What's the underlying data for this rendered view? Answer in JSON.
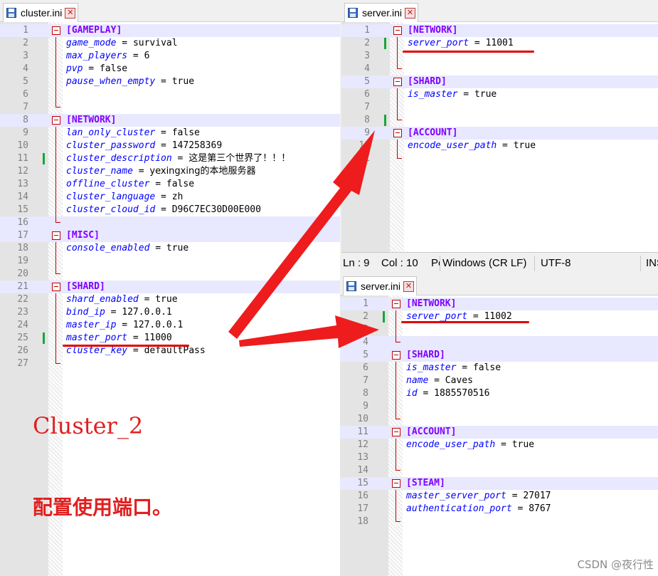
{
  "colors": {
    "section": "#8000ff",
    "key": "#0000ff",
    "annotation": "#e00000",
    "change_marker": "#17a63a"
  },
  "left": {
    "tab_label": "cluster.ini",
    "lines": [
      {
        "n": "1",
        "type": "section",
        "text": "[GAMEPLAY]"
      },
      {
        "n": "2",
        "key": "game_mode",
        "value": "survival"
      },
      {
        "n": "3",
        "key": "max_players",
        "value": "6"
      },
      {
        "n": "4",
        "key": "pvp",
        "value": "false"
      },
      {
        "n": "5",
        "key": "pause_when_empty",
        "value": "true"
      },
      {
        "n": "6",
        "type": "blank"
      },
      {
        "n": "7",
        "type": "blank"
      },
      {
        "n": "8",
        "type": "section",
        "text": "[NETWORK]"
      },
      {
        "n": "9",
        "key": "lan_only_cluster",
        "value": "false"
      },
      {
        "n": "10",
        "key": "cluster_password",
        "value": "147258369"
      },
      {
        "n": "11",
        "key": "cluster_description",
        "value": "这是第三个世界了！！！"
      },
      {
        "n": "12",
        "key": "cluster_name",
        "value": "yexingxing的本地服务器"
      },
      {
        "n": "13",
        "key": "offline_cluster",
        "value": "false"
      },
      {
        "n": "14",
        "key": "cluster_language",
        "value": "zh"
      },
      {
        "n": "15",
        "key": "cluster_cloud_id",
        "value": "D96C7EC30D00E000"
      },
      {
        "n": "16",
        "type": "blank"
      },
      {
        "n": "17",
        "type": "section",
        "text": "[MISC]"
      },
      {
        "n": "18",
        "key": "console_enabled",
        "value": "true"
      },
      {
        "n": "19",
        "type": "blank"
      },
      {
        "n": "20",
        "type": "blank"
      },
      {
        "n": "21",
        "type": "section",
        "text": "[SHARD]"
      },
      {
        "n": "22",
        "key": "shard_enabled",
        "value": "true"
      },
      {
        "n": "23",
        "key": "bind_ip",
        "value": "127.0.0.1"
      },
      {
        "n": "24",
        "key": "master_ip",
        "value": "127.0.0.1"
      },
      {
        "n": "25",
        "key": "master_port",
        "value": "11000"
      },
      {
        "n": "26",
        "key": "cluster_key",
        "value": "defaultPass"
      },
      {
        "n": "27",
        "type": "blank"
      }
    ]
  },
  "top_right": {
    "tab_label": "server.ini",
    "lines": [
      {
        "n": "1",
        "type": "section",
        "text": "[NETWORK]"
      },
      {
        "n": "2",
        "key": "server_port",
        "value": "11001"
      },
      {
        "n": "3",
        "type": "blank"
      },
      {
        "n": "4",
        "type": "blank"
      },
      {
        "n": "5",
        "type": "section",
        "text": "[SHARD]"
      },
      {
        "n": "6",
        "key": "is_master",
        "value": "true"
      },
      {
        "n": "7",
        "type": "blank"
      },
      {
        "n": "8",
        "type": "blank"
      },
      {
        "n": "9",
        "type": "section",
        "text": "[ACCOUNT]"
      },
      {
        "n": "10",
        "key": "encode_user_path",
        "value": "true"
      },
      {
        "n": "11",
        "type": "blank"
      }
    ]
  },
  "status": {
    "ln": "Ln : 9",
    "col": "Col : 10",
    "pos": "Pos",
    "eol": "Windows (CR LF)",
    "enc": "UTF-8",
    "ins": "INS"
  },
  "bottom_right": {
    "tab_label": "server.ini",
    "lines": [
      {
        "n": "1",
        "type": "section",
        "text": "[NETWORK]"
      },
      {
        "n": "2",
        "key": "server_port",
        "value": "11002"
      },
      {
        "n": "3",
        "type": "blank"
      },
      {
        "n": "4",
        "type": "blank"
      },
      {
        "n": "5",
        "type": "section",
        "text": "[SHARD]"
      },
      {
        "n": "6",
        "key": "is_master",
        "value": "false"
      },
      {
        "n": "7",
        "key": "name",
        "value": "Caves"
      },
      {
        "n": "8",
        "key": "id",
        "value": "1885570516"
      },
      {
        "n": "9",
        "type": "blank"
      },
      {
        "n": "10",
        "type": "blank"
      },
      {
        "n": "11",
        "type": "section",
        "text": "[ACCOUNT]"
      },
      {
        "n": "12",
        "key": "encode_user_path",
        "value": "true"
      },
      {
        "n": "13",
        "type": "blank"
      },
      {
        "n": "14",
        "type": "blank"
      },
      {
        "n": "15",
        "type": "section",
        "text": "[STEAM]"
      },
      {
        "n": "16",
        "key": "master_server_port",
        "value": "27017"
      },
      {
        "n": "17",
        "key": "authentication_port",
        "value": "8767"
      },
      {
        "n": "18",
        "type": "blank"
      }
    ]
  },
  "annotation": {
    "title": "Cluster_2",
    "subtitle": "配置使用端口。"
  },
  "watermark": "CSDN @夜行性"
}
